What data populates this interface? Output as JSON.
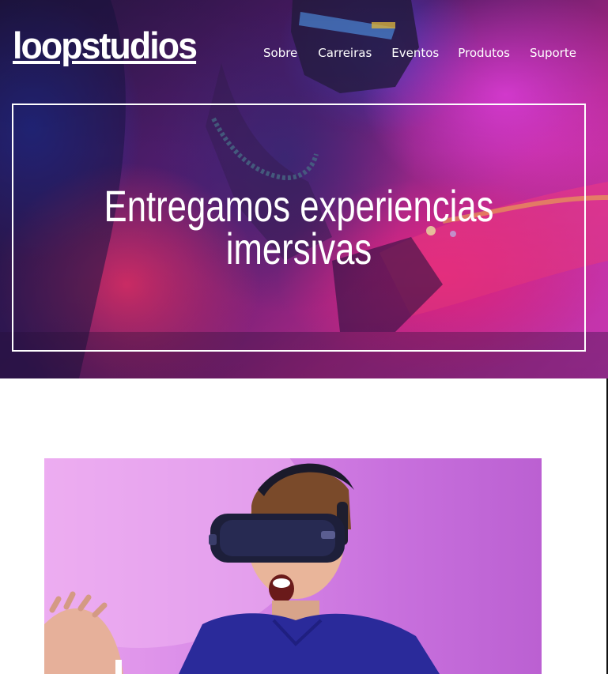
{
  "brand": {
    "logo": "loopstudios"
  },
  "nav": {
    "items": [
      {
        "label": "Sobre"
      },
      {
        "label": "Carreiras"
      },
      {
        "label": "Eventos"
      },
      {
        "label": "Produtos"
      },
      {
        "label": "Suporte"
      }
    ]
  },
  "hero": {
    "title": "Entregamos experiencias imersivas",
    "image_icon": "vr-gamer-photo"
  },
  "content": {
    "image_icon": "man-with-vr-headset-photo"
  },
  "colors": {
    "hero_magenta": "#e83fd0",
    "hero_pink": "#ff2890",
    "photo_background": "#d98be8",
    "text": "#ffffff",
    "page_background": "#ffffff"
  }
}
